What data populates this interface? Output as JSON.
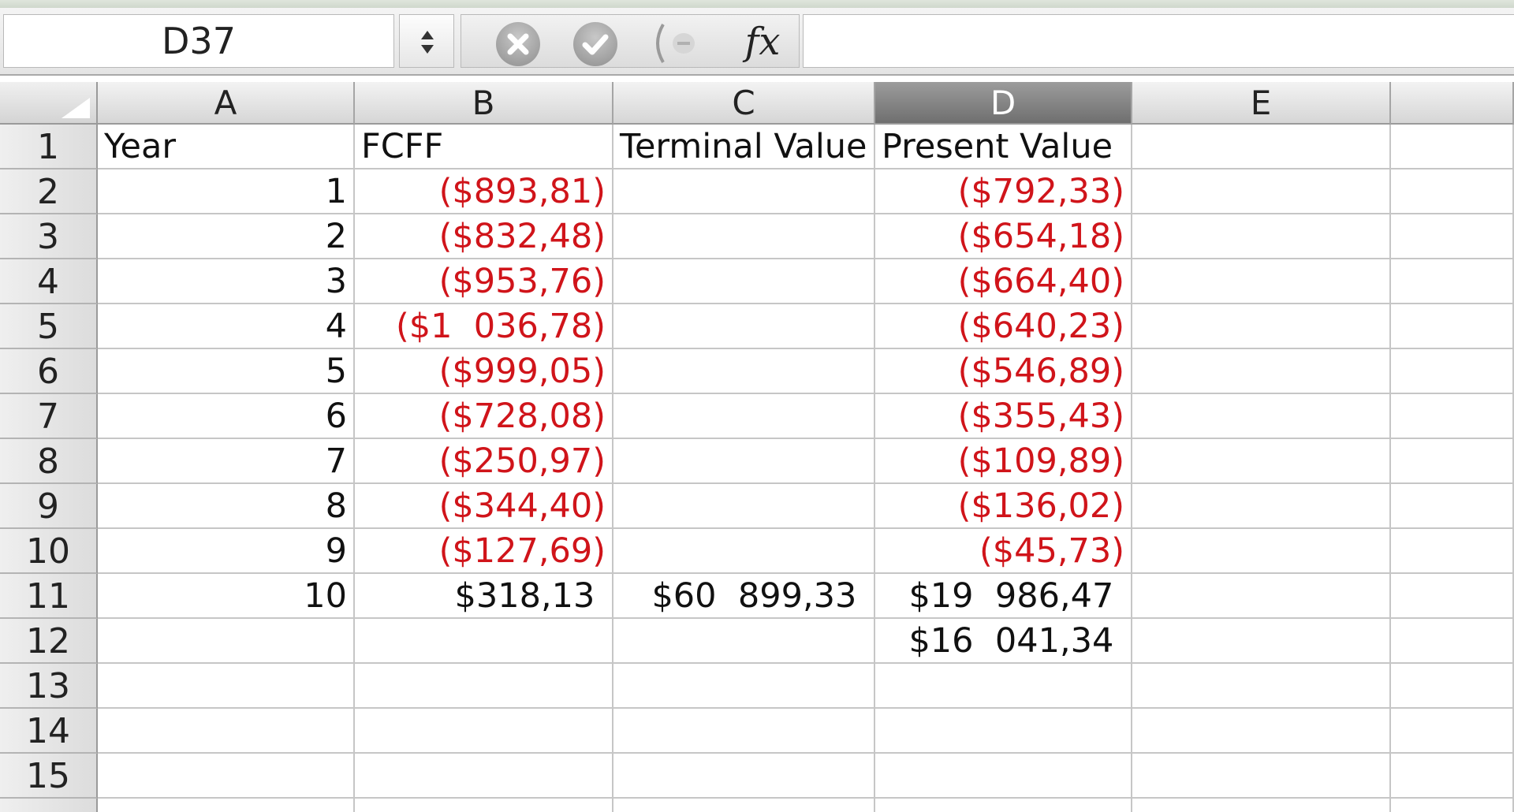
{
  "formula_bar": {
    "name_box": "D37",
    "fx_label": "fx",
    "formula": ""
  },
  "columns": [
    "A",
    "B",
    "C",
    "D",
    "E"
  ],
  "selected_column": "D",
  "rows": [
    "1",
    "2",
    "3",
    "4",
    "5",
    "6",
    "7",
    "8",
    "9",
    "10",
    "11",
    "12",
    "13",
    "14",
    "15"
  ],
  "cells": [
    {
      "a": "Year",
      "b": "FCFF",
      "c": "Terminal Value",
      "d": "Present Value",
      "e": ""
    },
    {
      "a": "1",
      "b": "($893,81)",
      "c": "",
      "d": "($792,33)",
      "e": ""
    },
    {
      "a": "2",
      "b": "($832,48)",
      "c": "",
      "d": "($654,18)",
      "e": ""
    },
    {
      "a": "3",
      "b": "($953,76)",
      "c": "",
      "d": "($664,40)",
      "e": ""
    },
    {
      "a": "4",
      "b": "($1  036,78)",
      "c": "",
      "d": "($640,23)",
      "e": ""
    },
    {
      "a": "5",
      "b": "($999,05)",
      "c": "",
      "d": "($546,89)",
      "e": ""
    },
    {
      "a": "6",
      "b": "($728,08)",
      "c": "",
      "d": "($355,43)",
      "e": ""
    },
    {
      "a": "7",
      "b": "($250,97)",
      "c": "",
      "d": "($109,89)",
      "e": ""
    },
    {
      "a": "8",
      "b": "($344,40)",
      "c": "",
      "d": "($136,02)",
      "e": ""
    },
    {
      "a": "9",
      "b": "($127,69)",
      "c": "",
      "d": "($45,73)",
      "e": ""
    },
    {
      "a": "10",
      "b": "$318,13 ",
      "c": "$60  899,33 ",
      "d": "$19  986,47 ",
      "e": ""
    },
    {
      "a": "",
      "b": "",
      "c": "",
      "d": "$16  041,34 ",
      "e": ""
    },
    {
      "a": "",
      "b": "",
      "c": "",
      "d": "",
      "e": ""
    },
    {
      "a": "",
      "b": "",
      "c": "",
      "d": "",
      "e": ""
    },
    {
      "a": "",
      "b": "",
      "c": "",
      "d": "",
      "e": ""
    }
  ],
  "colors": {
    "negative_text": "#d0141a",
    "selected_header": "#7f7f7f"
  }
}
